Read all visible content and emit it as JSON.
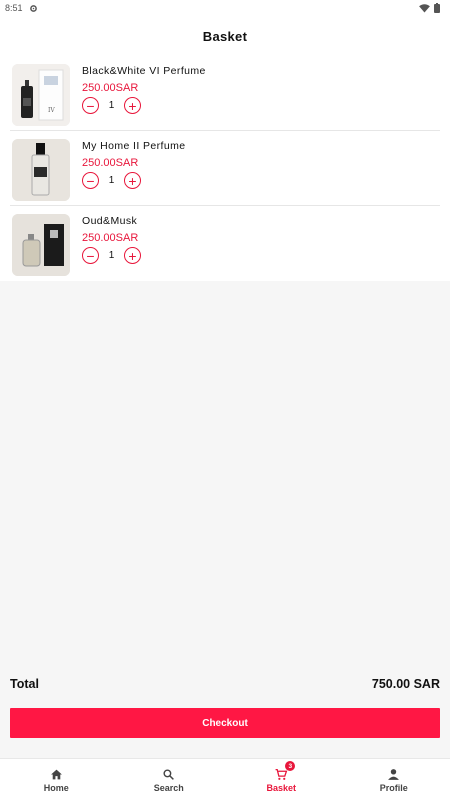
{
  "status_bar": {
    "time": "8:51"
  },
  "header": {
    "title": "Basket"
  },
  "items": [
    {
      "name": "Black&White VI Perfume",
      "price": "250.00SAR",
      "quantity": "1"
    },
    {
      "name": "My Home II Perfume",
      "price": "250.00SAR",
      "quantity": "1"
    },
    {
      "name": "Oud&Musk",
      "price": "250.00SAR",
      "quantity": "1"
    }
  ],
  "summary": {
    "total_label": "Total",
    "total_value": "750.00 SAR",
    "checkout_label": "Checkout"
  },
  "nav": {
    "items": [
      {
        "label": "Home",
        "icon": "home-icon"
      },
      {
        "label": "Search",
        "icon": "search-icon"
      },
      {
        "label": "Basket",
        "icon": "cart-icon",
        "badge": "3",
        "active": true
      },
      {
        "label": "Profile",
        "icon": "person-icon"
      }
    ]
  },
  "colors": {
    "accent": "#e8163b",
    "checkout": "#ff1744"
  }
}
